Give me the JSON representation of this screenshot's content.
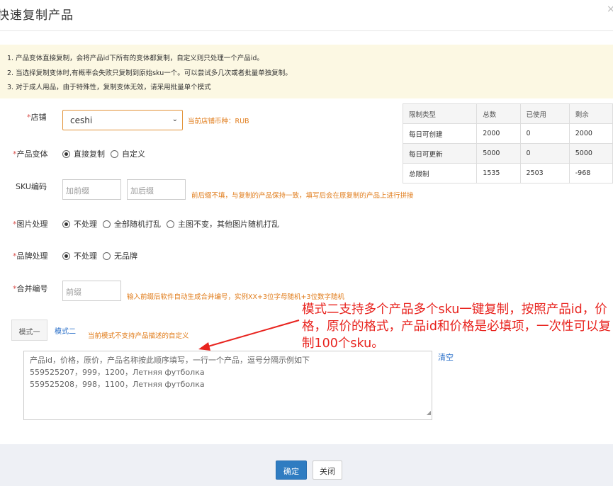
{
  "dialog": {
    "title": "快速复制产品",
    "close_icon": "×"
  },
  "notice": {
    "lines": [
      "1. 产品变体直接复制，会将产品id下所有的变体都复制，自定义则只处理一个产品id。",
      "2. 当选择复制变体时,有概率会失败只复制到原始sku一个。可以尝试多几次或者批量单独复制。",
      "3. 对于成人用品，由于特殊性，复制变体无效，请采用批量单个模式"
    ]
  },
  "store": {
    "label": "店铺",
    "value": "ceshi",
    "currency_hint": "当前店铺币种：RUB"
  },
  "variant": {
    "label": "产品变体",
    "options": [
      "直接复制",
      "自定义"
    ],
    "selected": 0
  },
  "sku": {
    "label": "SKU编码",
    "prefix_placeholder": "加前缀",
    "suffix_placeholder": "加后缀",
    "hint": "前后缀不填，与复制的产品保持一致，填写后会在原复制的产品上进行拼接"
  },
  "image": {
    "label": "图片处理",
    "options": [
      "不处理",
      "全部随机打乱",
      "主图不变，其他图片随机打乱"
    ],
    "selected": 0
  },
  "brand": {
    "label": "品牌处理",
    "options": [
      "不处理",
      "无品牌"
    ],
    "selected": 0
  },
  "merge": {
    "label": "合并编号",
    "placeholder": "前缀",
    "hint": "输入前缀后软件自动生成合并编号，实例XX+3位字母随机+3位数字随机"
  },
  "limits": {
    "headers": [
      "限制类型",
      "总数",
      "已使用",
      "剩余"
    ],
    "rows": [
      [
        "每日可创建",
        "2000",
        "0",
        "2000"
      ],
      [
        "每日可更新",
        "5000",
        "0",
        "5000"
      ],
      [
        "总限制",
        "1535",
        "2503",
        "-968"
      ]
    ]
  },
  "tabs": {
    "items": [
      "模式一",
      "模式二"
    ],
    "active": 1,
    "hint": "当前模式不支持产品描述的自定义"
  },
  "textarea": {
    "lines": [
      "产品id，价格，原价，产品名称按此顺序填写，一行一个产品，逗号分隔示例如下",
      "559525207，999，1200，Летняя футболка",
      "559525208，998，1100，Летняя футболка"
    ],
    "clear_label": "清空"
  },
  "annotation": {
    "text": "模式二支持多个产品多个sku一键复制，按照产品id，价格，原价的格式，产品id和价格是必填项，一次性可以复制100个sku。",
    "color": "#e8231e"
  },
  "footer": {
    "ok_label": "确定",
    "close_label": "关闭"
  },
  "colors": {
    "accent": "#2f7cc1",
    "hint": "#e07b19",
    "required": "#d9534f",
    "notice_bg": "#fcf8e3"
  }
}
